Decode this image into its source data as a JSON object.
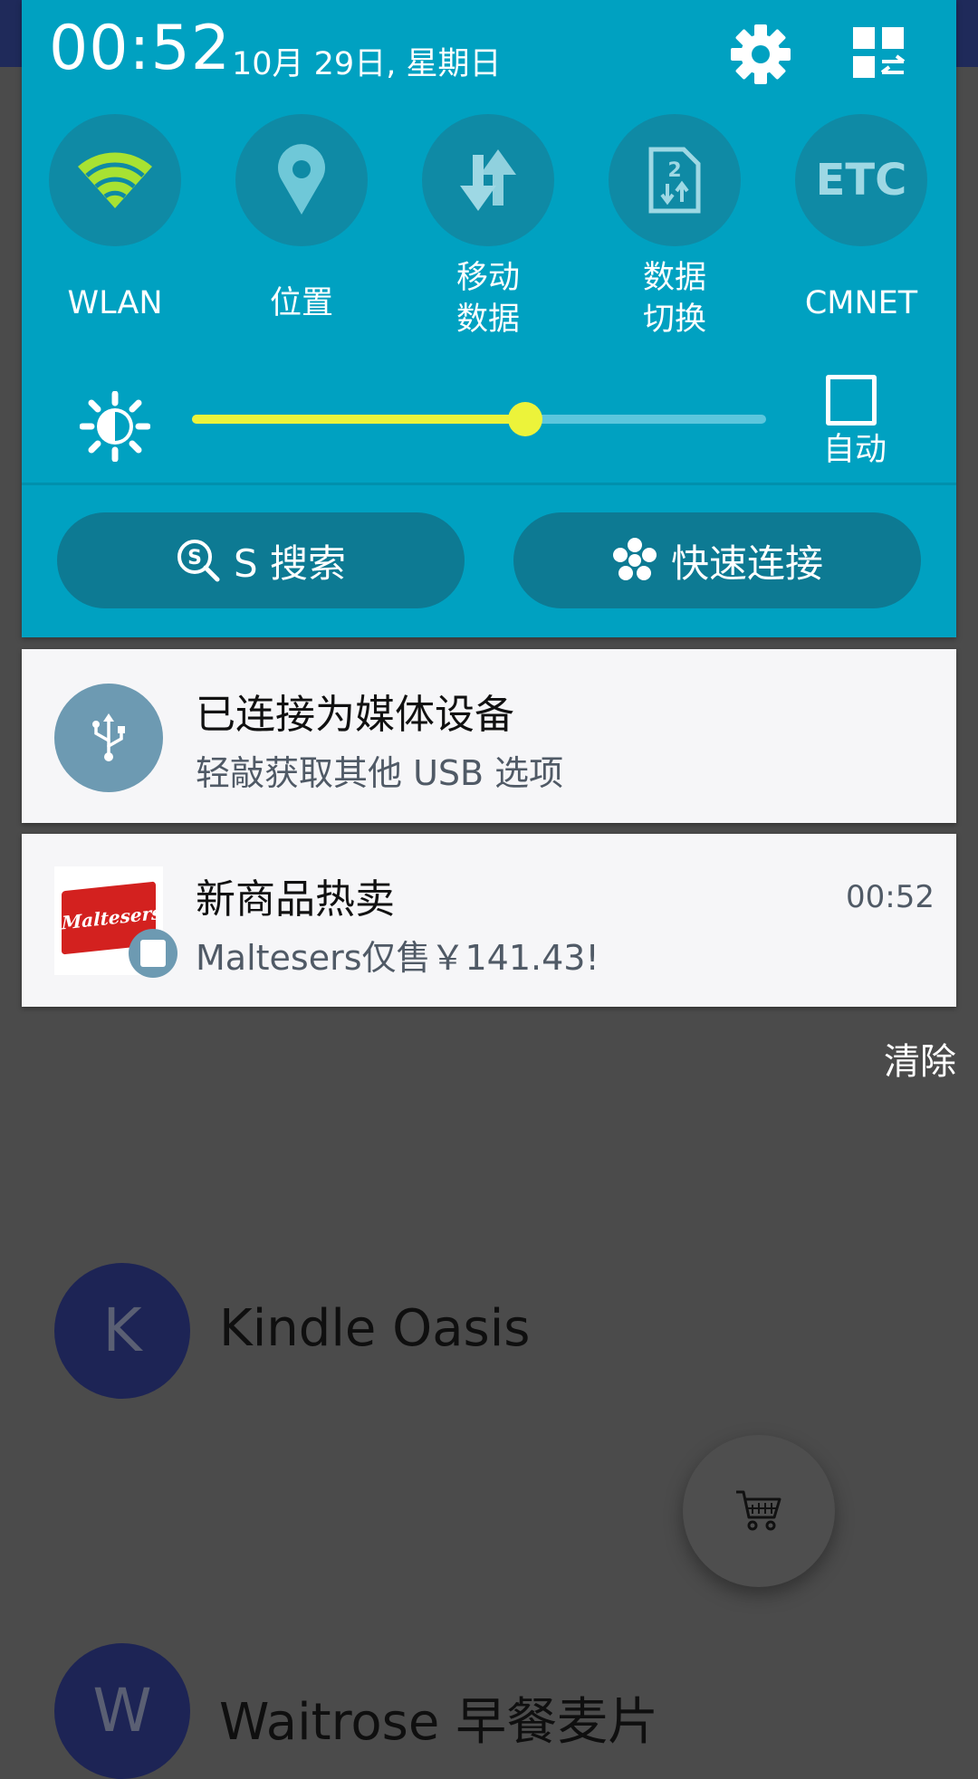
{
  "status": {
    "time": "00:52",
    "date": "10月 29日, 星期日"
  },
  "quick_toggles": [
    {
      "label": "WLAN",
      "icon": "wifi-icon"
    },
    {
      "label": "位置",
      "icon": "location-icon"
    },
    {
      "label": "移动\n数据",
      "icon": "mobile-data-icon"
    },
    {
      "label": "数据\n切换",
      "icon": "sim-switch-icon"
    },
    {
      "label": "CMNET",
      "icon": "etc-icon",
      "icon_text": "ETC"
    }
  ],
  "brightness": {
    "level_fraction": 0.58,
    "auto_label": "自动",
    "auto_checked": false
  },
  "actions": {
    "s_search": "S 搜索",
    "quick_connect": "快速连接"
  },
  "notifications": [
    {
      "title": "已连接为媒体设备",
      "text": "轻敲获取其他 USB 选项"
    },
    {
      "title": "新商品热卖",
      "text": "Maltesers仅售￥141.43!",
      "time": "00:52",
      "image_text": "Maltesers"
    }
  ],
  "clear_label": "清除",
  "background_list": [
    {
      "initial": "K",
      "title": "Kindle Oasis"
    },
    {
      "initial": "W",
      "title": "Waitrose 早餐麦片"
    }
  ],
  "colors": {
    "shade": "#00a1c1",
    "slider_active": "#ecf33a",
    "wifi_active": "#a8e232"
  }
}
